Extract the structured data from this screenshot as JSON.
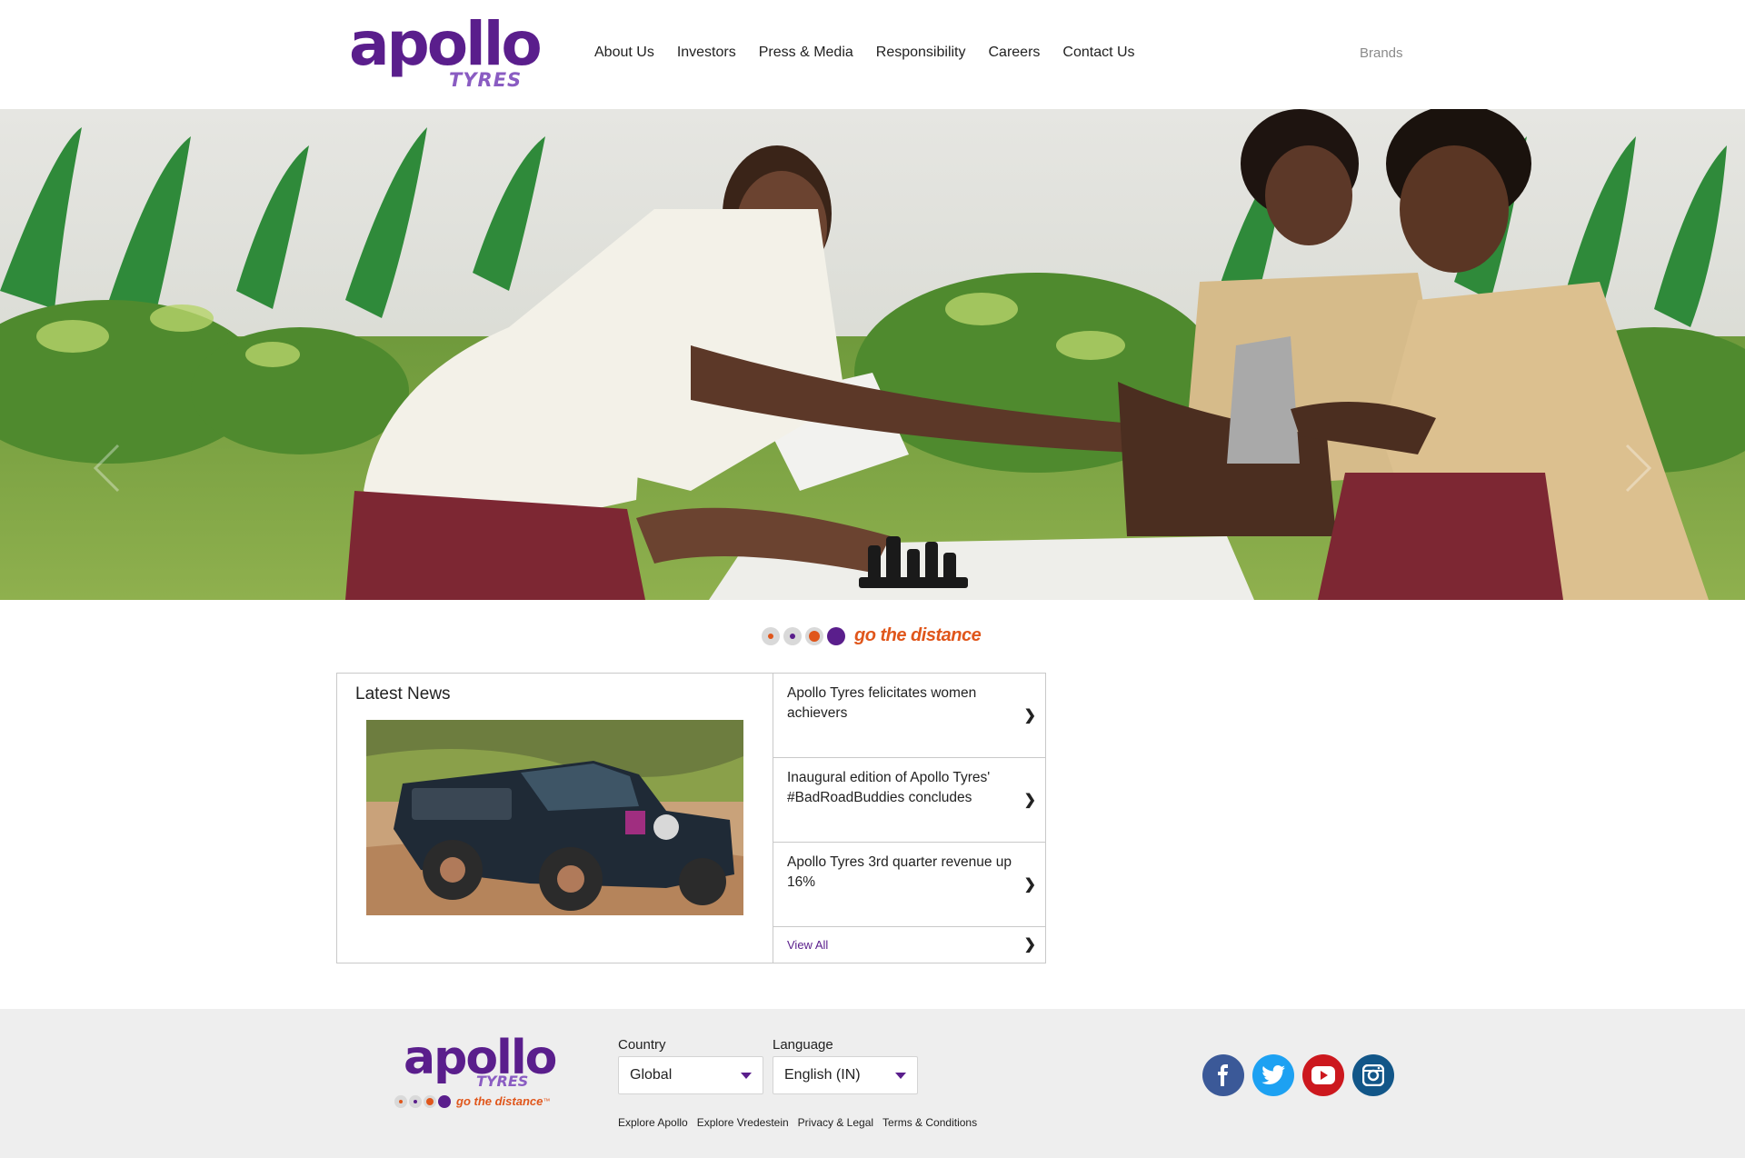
{
  "header": {
    "logo_word": "apollo",
    "logo_sub": "TYRES",
    "nav": [
      "About Us",
      "Investors",
      "Press & Media",
      "Responsibility",
      "Careers",
      "Contact Us"
    ],
    "brands": "Brands"
  },
  "tagline": {
    "text": "go the distance",
    "dot_colors": [
      "#c8c8c8",
      "#a58dc6",
      "#e0561b",
      "#5a1e8c"
    ]
  },
  "news": {
    "title": "Latest News",
    "items": [
      "Apollo Tyres felicitates women achievers",
      "Inaugural edition of Apollo Tyres' #BadRoadBuddies concludes",
      "Apollo Tyres 3rd quarter revenue up 16%"
    ],
    "view_all": "View All"
  },
  "footer": {
    "logo_word": "apollo",
    "logo_sub": "TYRES",
    "logo_tag": "go the distance",
    "logo_tm": "™",
    "country_label": "Country",
    "country_value": "Global",
    "language_label": "Language",
    "language_value": "English (IN)",
    "links": [
      "Explore Apollo",
      "Explore Vredestein",
      "Privacy & Legal",
      "Terms & Conditions"
    ],
    "social": [
      "facebook-icon",
      "twitter-icon",
      "youtube-icon",
      "instagram-icon"
    ]
  },
  "colors": {
    "brand_purple": "#5a1e8c",
    "brand_orange": "#e0561b",
    "facebook": "#3b5998",
    "twitter": "#1da1f2",
    "youtube": "#cc181e",
    "instagram": "#125688"
  }
}
